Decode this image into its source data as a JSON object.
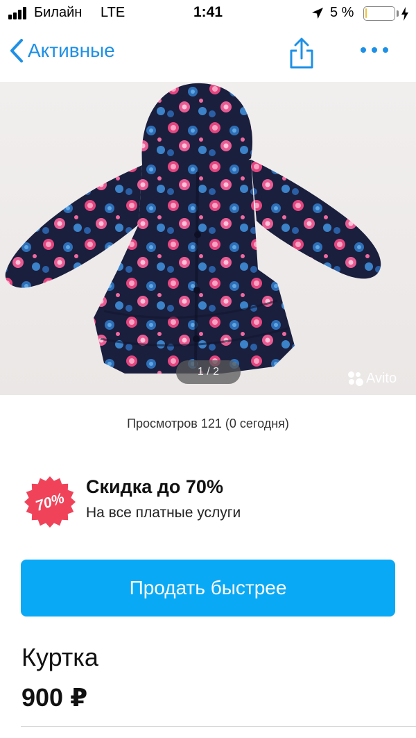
{
  "status_bar": {
    "carrier": "Билайн",
    "network": "LTE",
    "time": "1:41",
    "battery_text": "5 %",
    "battery_level": 0.05,
    "icons": [
      "signal-icon",
      "location-arrow-icon",
      "battery-icon",
      "charging-bolt-icon"
    ]
  },
  "nav": {
    "back_label": "Активные",
    "icons": [
      "chevron-left-icon",
      "share-icon",
      "more-dots-icon"
    ],
    "accent_color": "#1e90e6"
  },
  "gallery": {
    "pager": "1 / 2",
    "watermark": "Avito",
    "current_page": 1,
    "total_pages": 2
  },
  "stats": {
    "views": "Просмотров 121 (0 сегодня)"
  },
  "promo": {
    "badge_text": "70%",
    "title": "Скидка до 70%",
    "subtitle": "На все платные услуги",
    "badge_color": "#f0435a"
  },
  "actions": {
    "sell_faster": "Продать быстрее",
    "button_color": "#0aa9f5"
  },
  "item": {
    "title": "Куртка",
    "price": "900 ₽"
  }
}
